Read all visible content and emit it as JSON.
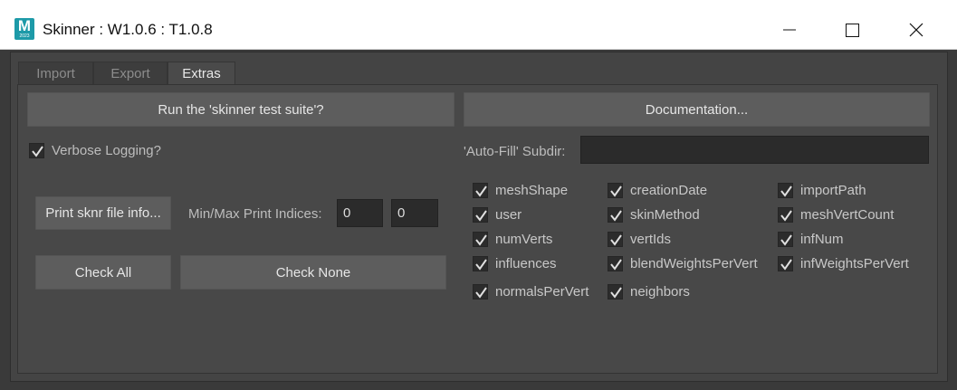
{
  "window": {
    "title": "Skinner : W1.0.6 : T1.0.8",
    "icon_letter": "M",
    "icon_sub": "2023"
  },
  "tabs": [
    {
      "label": "Import",
      "active": false
    },
    {
      "label": "Export",
      "active": false
    },
    {
      "label": "Extras",
      "active": true
    }
  ],
  "extras": {
    "run_tests_label": "Run the 'skinner test suite'?",
    "documentation_label": "Documentation...",
    "verbose_label": "Verbose Logging?",
    "verbose_checked": true,
    "autofill_label": "'Auto-Fill' Subdir:",
    "autofill_value": "",
    "print_button_label": "Print sknr file info...",
    "minmax_label": "Min/Max Print Indices:",
    "min_value": "0",
    "max_value": "0",
    "check_all_label": "Check All",
    "check_none_label": "Check None",
    "fields": [
      {
        "label": "meshShape",
        "checked": true
      },
      {
        "label": "creationDate",
        "checked": true
      },
      {
        "label": "importPath",
        "checked": true
      },
      {
        "label": "user",
        "checked": true
      },
      {
        "label": "skinMethod",
        "checked": true
      },
      {
        "label": "meshVertCount",
        "checked": true
      },
      {
        "label": "numVerts",
        "checked": true
      },
      {
        "label": "vertIds",
        "checked": true
      },
      {
        "label": "infNum",
        "checked": true
      },
      {
        "label": "influences",
        "checked": true
      },
      {
        "label": "blendWeightsPerVert",
        "checked": true
      },
      {
        "label": "infWeightsPerVert",
        "checked": true
      },
      {
        "label": "normalsPerVert",
        "checked": true
      },
      {
        "label": "neighbors",
        "checked": true
      }
    ]
  },
  "colors": {
    "accent_icon": "#1d9aa8",
    "background": "#444444",
    "button": "#5d5d5d"
  },
  "icons": {
    "minimize": "minimize-icon",
    "maximize": "maximize-icon",
    "close": "close-icon",
    "check": "checkmark-icon"
  }
}
